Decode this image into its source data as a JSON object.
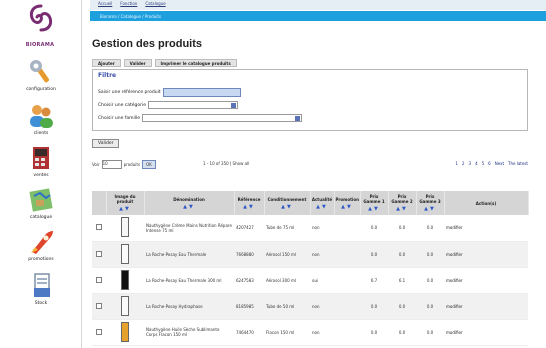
{
  "brand": {
    "logo_text": "BIORAMA"
  },
  "topbar": {
    "menu": [
      "Accueil",
      "Fonction",
      "Catalogue"
    ],
    "breadcrumb": "Biorama / Catalogue / Produits"
  },
  "sidebar": {
    "items": [
      {
        "label": "configuration",
        "icon": "wrench-icon"
      },
      {
        "label": "clients",
        "icon": "users-icon"
      },
      {
        "label": "ventes",
        "icon": "cash-register-icon"
      },
      {
        "label": "catalogue",
        "icon": "map-icon"
      },
      {
        "label": "promotions",
        "icon": "rocket-icon"
      },
      {
        "label": "Stock",
        "icon": "document-icon"
      }
    ]
  },
  "page": {
    "title": "Gestion des produits",
    "actions": [
      "Ajouter",
      "Valider",
      "Imprimer le catalogue produits"
    ]
  },
  "filters": {
    "title": "Filtre",
    "reference_label": "Saisir une référence produit",
    "reference_value": "",
    "category_label": "Choisir une catégorie",
    "category_value": "",
    "family_label": "Choisir une famille",
    "family_value": "",
    "validate_label": "Valider"
  },
  "pager": {
    "per_label": "Voir",
    "per_value": "10",
    "per_suffix": "produits",
    "ok_label": "OK",
    "range_text": "1 - 10 of 350 | Show all",
    "pages": [
      "1",
      "2",
      "3",
      "4",
      "5",
      "6",
      "Next",
      "The latest"
    ]
  },
  "table": {
    "columns": [
      "",
      "Image du produit",
      "Dénomination",
      "Référence",
      "Conditionnement",
      "Actualité",
      "Promotion",
      "Prix Gamme 1",
      "Prix Gamme 2",
      "Prix Gamme 3",
      "Action(s)"
    ],
    "rows": [
      {
        "thumb": "tube",
        "name": "Nauthygène Crème Mains Nutrition Répare Intense 75 ml",
        "ref": "4207427",
        "pack": "Tube de 75 ml",
        "news": "non",
        "promo": "",
        "p1": "0.0",
        "p2": "0.0",
        "p3": "0.0",
        "action": "modifier"
      },
      {
        "thumb": "light",
        "name": "La Roche-Posay Eau Thermale",
        "ref": "7668880",
        "pack": "Aérosol 150 ml",
        "news": "non",
        "promo": "",
        "p1": "0.0",
        "p2": "0.0",
        "p3": "0.0",
        "action": "modifier"
      },
      {
        "thumb": "dark",
        "name": "La Roche-Posay Eau Thermale 300 ml",
        "ref": "6247583",
        "pack": "Aérosol 300 ml",
        "news": "oui",
        "promo": "",
        "p1": "6.7",
        "p2": "6.1",
        "p3": "0.0",
        "action": "modifier"
      },
      {
        "thumb": "light",
        "name": "La Roche-Posay Hydraphase",
        "ref": "8185985",
        "pack": "Tube de 50 ml",
        "news": "non",
        "promo": "",
        "p1": "0.0",
        "p2": "0.0",
        "p3": "0.0",
        "action": "modifier"
      },
      {
        "thumb": "gold",
        "name": "Nauthygène Huile Sèche Sublimante Corps Flacon 150 ml",
        "ref": "7464470",
        "pack": "Flacon 150 ml",
        "news": "non",
        "promo": "",
        "p1": "0.0",
        "p2": "0.0",
        "p3": "0.0",
        "action": "modifier"
      }
    ]
  },
  "colors": {
    "accent_blue": "#1fa0de",
    "brand_purple": "#7a2c73",
    "header_gray": "#d5d5d5"
  }
}
